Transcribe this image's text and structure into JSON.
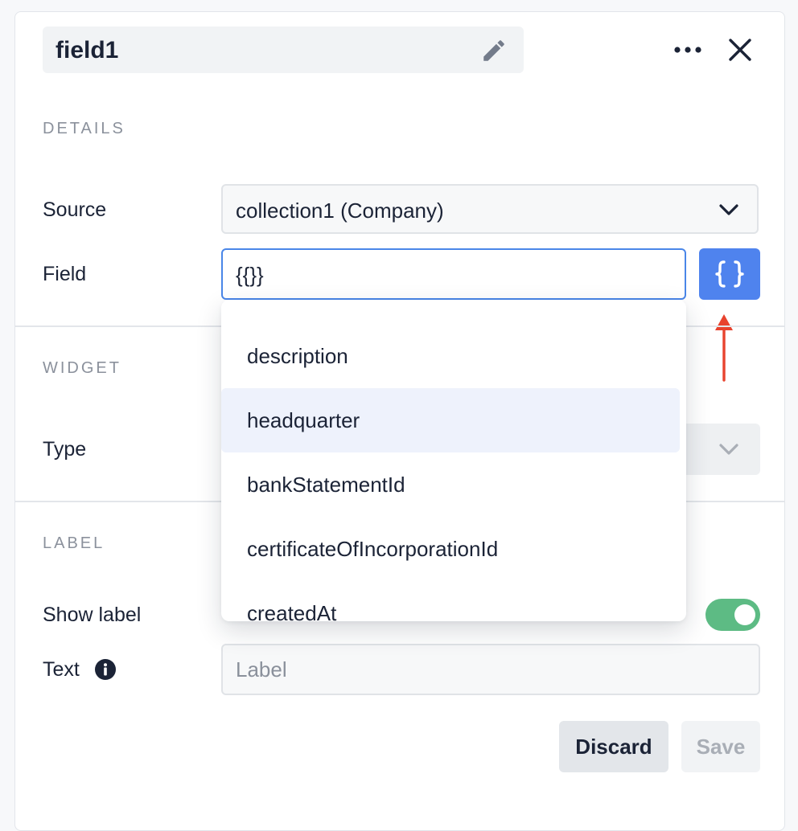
{
  "header": {
    "title": "field1"
  },
  "details": {
    "section_title": "DETAILS",
    "source_label": "Source",
    "source_value": "collection1 (Company)",
    "field_label": "Field",
    "field_value": "{{}}"
  },
  "field_dropdown": {
    "options": [
      "description",
      "headquarter",
      "bankStatementId",
      "certificateOfIncorporationId",
      "createdAt"
    ],
    "highlighted": "headquarter"
  },
  "widget": {
    "section_title": "WIDGET",
    "type_label": "Type"
  },
  "label_section": {
    "section_title": "LABEL",
    "show_label_label": "Show label",
    "show_label_on": true,
    "text_label": "Text",
    "text_placeholder": "Label"
  },
  "actions": {
    "discard_label": "Discard",
    "save_label": "Save"
  },
  "colors": {
    "accent": "#4f83ee",
    "focus_border": "#4a86e8",
    "toggle_on": "#5dbb84",
    "annotation_arrow": "#e8432e"
  },
  "icons": {
    "edit": "pencil-icon",
    "more": "more-horizontal-icon",
    "close": "close-icon",
    "braces": "curly-braces-icon",
    "dropdown": "chevron-down-icon",
    "info": "info-icon"
  }
}
